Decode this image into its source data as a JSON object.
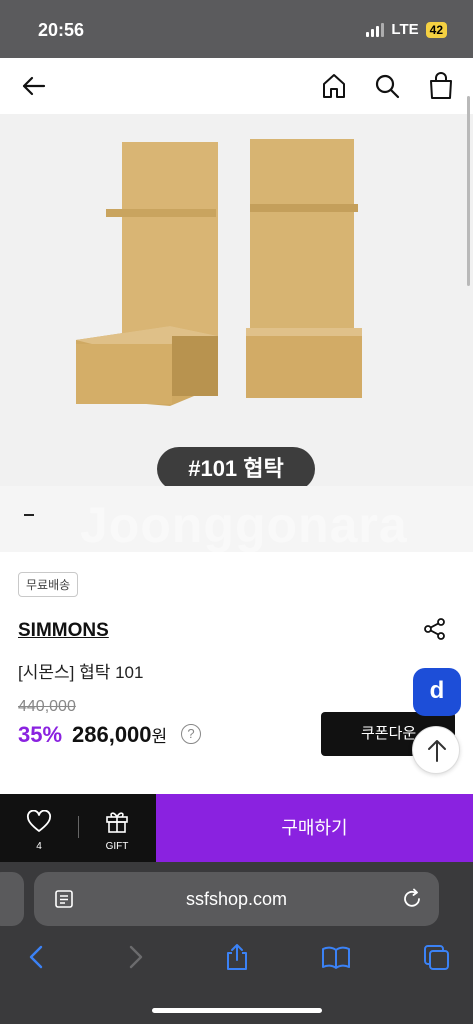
{
  "status": {
    "time": "20:56",
    "network": "LTE",
    "battery": "42"
  },
  "hero": {
    "label": "#101 협탁",
    "watermark": "Joonggonara"
  },
  "product": {
    "badge": "무료배송",
    "brand": "SIMMONS",
    "name": "[시몬스] 협탁 101",
    "original_price": "440,000",
    "discount": "35%",
    "price": "286,000",
    "currency": "원",
    "help": "?"
  },
  "coupon_label": "쿠폰다운",
  "fab_label": "d",
  "buybar": {
    "like_count": "4",
    "gift_label": "GIFT",
    "buy_label": "구매하기"
  },
  "browser": {
    "url": "ssfshop.com"
  },
  "colors": {
    "accent": "#8a22e0",
    "fab": "#1d4ed8"
  }
}
